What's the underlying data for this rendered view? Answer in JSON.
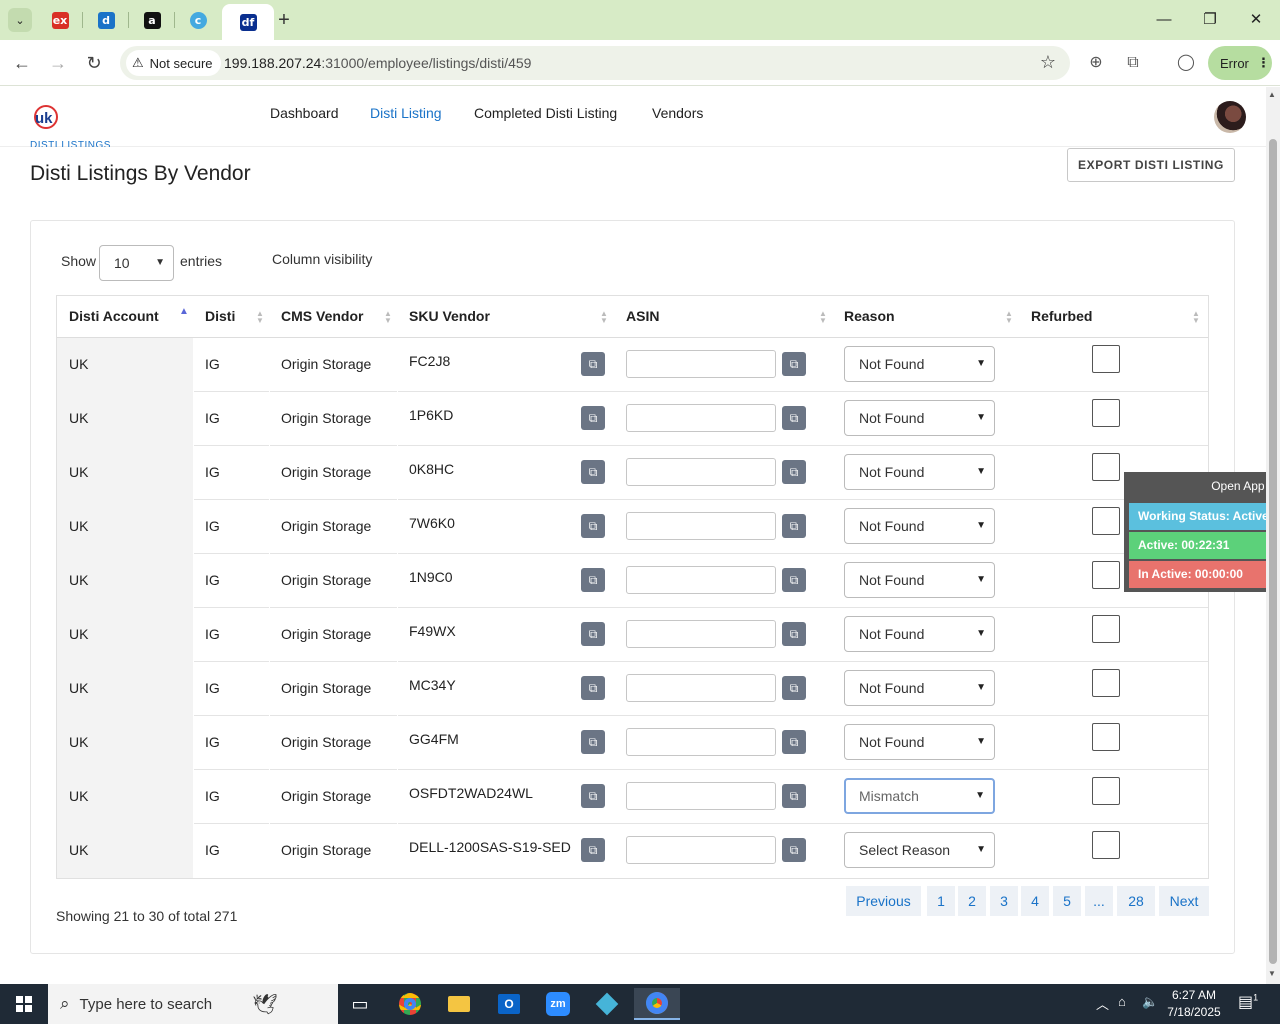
{
  "browser": {
    "tabs": [
      {
        "icon": "ex",
        "color": "#d93025"
      },
      {
        "icon": "d",
        "color": "#1a73c8"
      },
      {
        "icon": "a",
        "color": "#111111"
      },
      {
        "icon": "c",
        "color": "#44a9e0"
      },
      {
        "icon": "df",
        "color": "#0a2f8f",
        "active": true
      }
    ],
    "security_label": "Not secure",
    "url_host": "199.188.207.24",
    "url_rest": ":31000/employee/listings/disti/459",
    "profile_status": "Error"
  },
  "nav": {
    "items": [
      "Dashboard",
      "Disti Listing",
      "Completed Disti Listing",
      "Vendors"
    ],
    "active": "Disti Listing"
  },
  "page": {
    "breadcrumb": "DISTI LISTINGS",
    "title": "Disti Listings By Vendor",
    "export_label": "EXPORT DISTI LISTING"
  },
  "controls": {
    "show_label": "Show",
    "entries_value": "10",
    "entries_label": "entries",
    "column_visibility": "Column visibility"
  },
  "table": {
    "columns": [
      "Disti Account",
      "Disti",
      "CMS Vendor",
      "SKU Vendor",
      "ASIN",
      "Reason",
      "Refurbed"
    ],
    "rows": [
      {
        "account": "UK",
        "disti": "IG",
        "vendor": "Origin Storage",
        "sku": "FC2J8",
        "asin": "",
        "reason": "Not Found",
        "refurbed": false
      },
      {
        "account": "UK",
        "disti": "IG",
        "vendor": "Origin Storage",
        "sku": "1P6KD",
        "asin": "",
        "reason": "Not Found",
        "refurbed": false
      },
      {
        "account": "UK",
        "disti": "IG",
        "vendor": "Origin Storage",
        "sku": "0K8HC",
        "asin": "",
        "reason": "Not Found",
        "refurbed": false
      },
      {
        "account": "UK",
        "disti": "IG",
        "vendor": "Origin Storage",
        "sku": "7W6K0",
        "asin": "",
        "reason": "Not Found",
        "refurbed": false
      },
      {
        "account": "UK",
        "disti": "IG",
        "vendor": "Origin Storage",
        "sku": "1N9C0",
        "asin": "",
        "reason": "Not Found",
        "refurbed": false
      },
      {
        "account": "UK",
        "disti": "IG",
        "vendor": "Origin Storage",
        "sku": "F49WX",
        "asin": "",
        "reason": "Not Found",
        "refurbed": false
      },
      {
        "account": "UK",
        "disti": "IG",
        "vendor": "Origin Storage",
        "sku": "MC34Y",
        "asin": "",
        "reason": "Not Found",
        "refurbed": false
      },
      {
        "account": "UK",
        "disti": "IG",
        "vendor": "Origin Storage",
        "sku": "GG4FM",
        "asin": "",
        "reason": "Not Found",
        "refurbed": false
      },
      {
        "account": "UK",
        "disti": "IG",
        "vendor": "Origin Storage",
        "sku": "OSFDT2WAD24WL",
        "asin": "",
        "reason": "Mismatch",
        "refurbed": false,
        "focused": true
      },
      {
        "account": "UK",
        "disti": "IG",
        "vendor": "Origin Storage",
        "sku": "DELL-1200SAS-S19-SED",
        "asin": "",
        "reason": "Select Reason",
        "refurbed": false
      }
    ]
  },
  "footer": {
    "showing_text": "Showing 21 to 30 of total 271",
    "pagination": [
      "Previous",
      "1",
      "2",
      "3",
      "4",
      "5",
      "...",
      "28",
      "Next"
    ]
  },
  "widget": {
    "open_app": "Open App ↗",
    "working_status": "Working Status: Active",
    "active_time": "Active: 00:22:31",
    "inactive_time": "In Active: 00:00:00",
    "colors": {
      "status": "#5bc0de",
      "active": "#5cd17a",
      "inactive": "#e8736d"
    }
  },
  "taskbar": {
    "search_placeholder": "Type here to search",
    "time": "6:27 AM",
    "date": "7/18/2025",
    "notification_count": "1"
  }
}
